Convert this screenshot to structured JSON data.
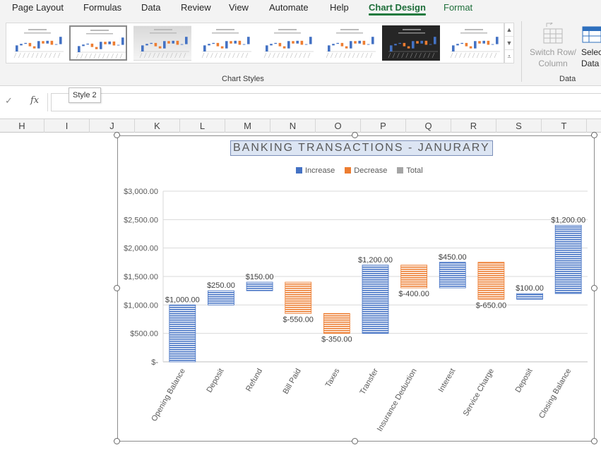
{
  "ribbon": {
    "tabs": [
      "Page Layout",
      "Formulas",
      "Data",
      "Review",
      "View",
      "Automate",
      "Help",
      "Chart Design",
      "Format"
    ],
    "active_tab": "Chart Design",
    "chart_styles_label": "Chart Styles",
    "data_group_label": "Data",
    "switch_row_column_line1": "Switch Row/",
    "switch_row_column_line2": "Column",
    "select_data_line1": "Selec",
    "select_data_line2": "Data",
    "tooltip": "Style 2"
  },
  "formula_bar": {
    "fx_label": "fx"
  },
  "columns": [
    "H",
    "I",
    "J",
    "K",
    "L",
    "M",
    "N",
    "O",
    "P",
    "Q",
    "R",
    "S",
    "T"
  ],
  "colors": {
    "increase": "#4472c4",
    "decrease": "#ed7d31",
    "total": "#a5a5a5",
    "accent": "#1e7a3e"
  },
  "chart_data": {
    "type": "bar",
    "subtype": "waterfall",
    "title": "BANKING TRANSACTIONS - JANURARY",
    "legend": [
      "Increase",
      "Decrease",
      "Total"
    ],
    "legend_position": "top",
    "categories": [
      "Opening Balance",
      "Deposit",
      "Refund",
      "Bill Paid",
      "Taxes",
      "Transfer",
      "Insurance Deduction",
      "Interest",
      "Service Charge",
      "Deposit",
      "Closing Balance"
    ],
    "values": [
      1000,
      250,
      150,
      -550,
      -350,
      1200,
      -400,
      450,
      -650,
      100,
      1200
    ],
    "value_labels": [
      "$1,000.00",
      "$250.00",
      "$150.00",
      "$-550.00",
      "$-350.00",
      "$1,200.00",
      "$-400.00",
      "$450.00",
      "$-650.00",
      "$100.00",
      "$1,200.00"
    ],
    "y_tick_labels": [
      "$-",
      "$500.00",
      "$1,000.00",
      "$1,500.00",
      "$2,000.00",
      "$2,500.00",
      "$3,000.00"
    ],
    "ylim": [
      0,
      3000
    ],
    "grid": true
  }
}
